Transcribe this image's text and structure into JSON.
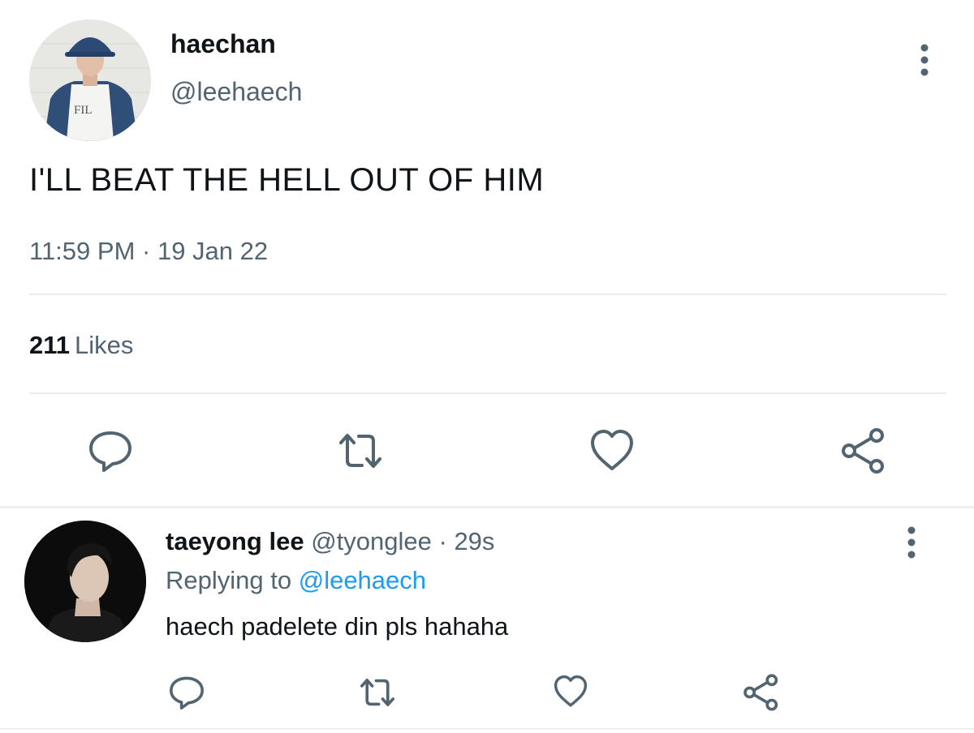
{
  "tweet": {
    "author_name": "haechan",
    "author_handle": "@leehaech",
    "text": "I'LL BEAT THE HELL OUT OF HIM",
    "time": "11:59 PM",
    "separator": " · ",
    "date": "19 Jan 22",
    "likes_count": "211",
    "likes_label": "Likes"
  },
  "reply": {
    "author_name": "taeyong lee",
    "author_handle": "@tyonglee",
    "age": "29s",
    "replying_prefix": "Replying to",
    "replying_handle": "@leehaech",
    "text": "haech padelete din pls hahaha"
  },
  "actions": [
    "reply-icon",
    "retweet-icon",
    "like-icon",
    "share-icon"
  ],
  "colors": {
    "text_primary": "#0f1419",
    "text_secondary": "#536471",
    "link": "#1d9bf0",
    "icon": "#536471",
    "divider": "#e6ecf0"
  }
}
